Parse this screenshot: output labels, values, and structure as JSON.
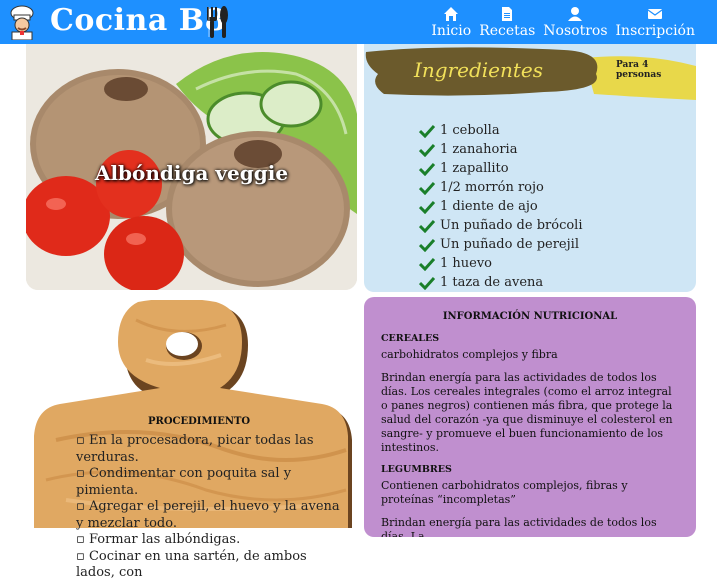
{
  "header": {
    "brand": "Cocina B8",
    "nav": [
      {
        "label": "Inicio",
        "icon": "home-icon"
      },
      {
        "label": "Recetas",
        "icon": "document-icon"
      },
      {
        "label": "Nosotros",
        "icon": "user-icon"
      },
      {
        "label": "Inscripción",
        "icon": "envelope-icon"
      }
    ],
    "background": "#1e90ff"
  },
  "hero": {
    "title": "Albóndiga veggie"
  },
  "ingredients": {
    "title": "Ingredientes",
    "servings": "Para 4 personas",
    "items": [
      "1 cebolla",
      "1 zanahoria",
      "1 zapallito",
      "1/2 morrón rojo",
      "1 diente de ajo",
      "Un puñado de brócoli",
      "Un puñado de perejil",
      "1 huevo",
      "1 taza de avena"
    ],
    "check_color": "#1a7f2a",
    "background": "#cfe6f5"
  },
  "procedure": {
    "title": "PROCEDIMIENTO",
    "steps": [
      "En la procesadora, picar todas las verduras.",
      "Condimentar con poquita sal y pimienta.",
      "Agregar el perejil, el huevo y la avena y mezclar todo.",
      "Formar las albóndigas.",
      "Cocinar en una sartén, de ambos lados, con"
    ]
  },
  "nutrition": {
    "title": "INFORMACIÓN NUTRICIONAL",
    "sections": [
      {
        "heading": "CEREALES",
        "paragraphs": [
          "carbohidratos complejos y fibra",
          "Brindan energía para las actividades de todos los días. Los cereales integrales (como el arroz integral o panes negros) contienen más fibra, que protege la salud del corazón -ya que disminuye el colesterol en sangre- y promueve el buen funcionamiento de los intestinos."
        ]
      },
      {
        "heading": "LEGUMBRES",
        "paragraphs": [
          "Contienen carbohidratos complejos, fibras y proteínas “incompletas”",
          "Brindan energía para las actividades de todos los días. La"
        ]
      }
    ],
    "background": "#c08fcf"
  }
}
